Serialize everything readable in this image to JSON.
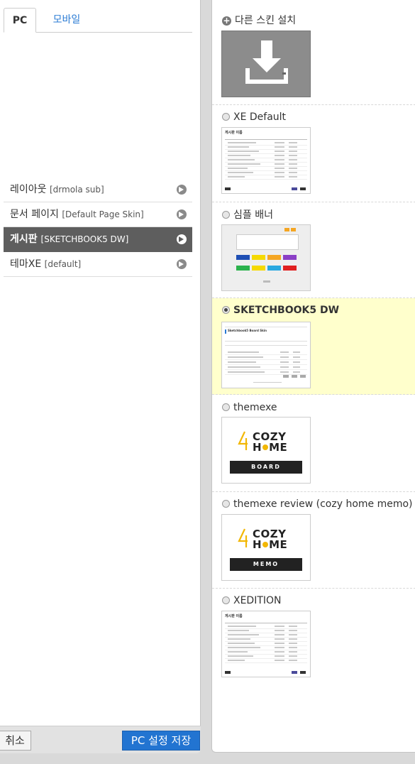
{
  "left": {
    "tabs": [
      {
        "label": "PC",
        "active": true
      },
      {
        "label": "모바일",
        "active": false
      }
    ],
    "menu": [
      {
        "label": "레이아웃",
        "skin": "[drmola sub]",
        "active": false
      },
      {
        "label": "문서 페이지",
        "skin": "[Default Page Skin]",
        "active": false
      },
      {
        "label": "게시판",
        "skin": "[SKETCHBOOK5 DW]",
        "active": true
      },
      {
        "label": "테마XE",
        "skin": "[default]",
        "active": false
      }
    ],
    "footer": {
      "cancel_label": "취소",
      "save_label": "PC 설정 저장"
    }
  },
  "right": {
    "install_label": "다른 스킨 설치",
    "skins": [
      {
        "label": "XE Default",
        "selected": false,
        "thumb": "list"
      },
      {
        "label": "심플 배너",
        "selected": false,
        "thumb": "banner"
      },
      {
        "label": "SKETCHBOOK5 DW",
        "selected": true,
        "thumb": "sketchbook"
      },
      {
        "label": "themexe",
        "selected": false,
        "thumb": "cozy",
        "logo_top": "COZY",
        "logo_bottom_left": "H",
        "logo_bottom_right": "ME",
        "bar": "BOARD"
      },
      {
        "label": "themexe review (cozy home memo)",
        "selected": false,
        "thumb": "cozy",
        "logo_top": "COZY",
        "logo_bottom_left": "H",
        "logo_bottom_right": "ME",
        "bar": "MEMO"
      },
      {
        "label": "XEDITION",
        "selected": false,
        "thumb": "list"
      }
    ]
  },
  "colors": {
    "accent": "#2274d1",
    "active_menu": "#5e5e5e",
    "selected_row": "#ffffcc",
    "cozy_yellow": "#f2b705"
  }
}
